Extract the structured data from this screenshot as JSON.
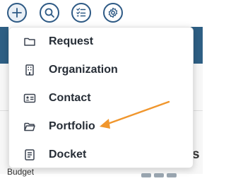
{
  "toolbar": {
    "buttons": [
      {
        "name": "add",
        "icon": "plus-icon"
      },
      {
        "name": "search",
        "icon": "search-icon"
      },
      {
        "name": "tasks",
        "icon": "checklist-icon"
      },
      {
        "name": "settings",
        "icon": "gear-icon"
      }
    ]
  },
  "menu": {
    "items": [
      {
        "label": "Request",
        "icon": "folder-icon"
      },
      {
        "label": "Organization",
        "icon": "building-icon"
      },
      {
        "label": "Contact",
        "icon": "contact-card-icon"
      },
      {
        "label": "Portfolio",
        "icon": "folder-open-icon"
      },
      {
        "label": "Docket",
        "icon": "docket-icon"
      }
    ]
  },
  "background": {
    "heading_fragment": "s",
    "label_fragment": "Budget"
  },
  "colors": {
    "toolbar_icon": "#2e5a85",
    "header_band": "#2e5f84",
    "menu_text": "#262d36",
    "annotation_arrow": "#f0962d"
  }
}
